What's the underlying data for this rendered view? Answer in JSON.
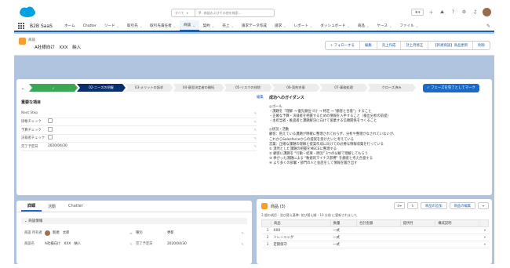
{
  "app": {
    "name": "B2B SaaS",
    "brand_color": "#00a1e0",
    "accent": "#1b6ac9"
  },
  "search": {
    "scope": "すべて",
    "placeholder": "商談およびその他を検索..."
  },
  "nav": {
    "items": [
      {
        "label": "ホーム",
        "dropdown": false
      },
      {
        "label": "Chatter",
        "dropdown": false
      },
      {
        "label": "リード",
        "dropdown": true
      },
      {
        "label": "取引先",
        "dropdown": true
      },
      {
        "label": "取引先責任者",
        "dropdown": true
      },
      {
        "label": "商談",
        "dropdown": true,
        "active": true
      },
      {
        "label": "契約",
        "dropdown": true
      },
      {
        "label": "売上",
        "dropdown": true
      },
      {
        "label": "請求データ作成",
        "dropdown": false
      },
      {
        "label": "請求",
        "dropdown": true
      },
      {
        "label": "レポート",
        "dropdown": true
      },
      {
        "label": "ダッシュボード",
        "dropdown": true
      },
      {
        "label": "商品",
        "dropdown": true
      },
      {
        "label": "ケース",
        "dropdown": true
      },
      {
        "label": "ファイル",
        "dropdown": true
      }
    ]
  },
  "record": {
    "type_label": "商談",
    "title": "A社様向け　XXX　納入",
    "actions": [
      "+ フォローする",
      "編集",
      "売上作成",
      "計上月修正",
      "【新規商談】商品更新",
      "削除"
    ]
  },
  "path": {
    "stages": [
      {
        "label": "✓",
        "state": "done"
      },
      {
        "label": "02-ニーズの把握",
        "state": "current"
      },
      {
        "label": "03-メリットの訴求",
        "state": "todo"
      },
      {
        "label": "04-意思決定者の開拓",
        "state": "todo"
      },
      {
        "label": "05-リスクの排除",
        "state": "todo"
      },
      {
        "label": "06-契約合意",
        "state": "todo"
      },
      {
        "label": "07-事務処理",
        "state": "todo"
      },
      {
        "label": "クローズ済み",
        "state": "todo"
      }
    ],
    "mark_button": "フェーズを完了としてマーク"
  },
  "key_fields": {
    "title": "重要な項目",
    "fields": [
      {
        "label": "Next Step",
        "value": "",
        "type": "text"
      },
      {
        "label": "掛帳チェック",
        "value": "",
        "type": "checkbox"
      },
      {
        "label": "予算チェック",
        "value": "",
        "type": "checkbox"
      },
      {
        "label": "決裁者チェック",
        "value": "",
        "type": "checkbox"
      },
      {
        "label": "完了予定日",
        "value": "2020/04/30",
        "type": "text"
      }
    ]
  },
  "guidance": {
    "edit_label": "編集",
    "title": "成功へのガイダンス",
    "lines": [
      {
        "text": "◎ゴール",
        "gap_before": false
      },
      {
        "text": "・課題を「理解 → 優先順位づけ → 特定 → \"顧客と合意\"」すること",
        "gap_before": false
      },
      {
        "text": "・正確な予算・決裁者を把握するための情報を入手すること（検出分析の前提）",
        "gap_before": false
      },
      {
        "text": "・主担当者・推進者と課題解決に向けて協業する信頼関係をつくること",
        "gap_before": false
      },
      {
        "text": "◎状況・活動",
        "gap_before": true
      },
      {
        "text": "顧客：抱えている課題が明確に整理されておらず、分析や整理がなされていないが、",
        "gap_before": false
      },
      {
        "text": "これからSalesforceからの提案を受けたいと考えている",
        "gap_before": false
      },
      {
        "text": "営業：正確な課題の理解と提案作成に向けての必要な情報収集を行っている",
        "gap_before": false
      },
      {
        "text": "① 漠然とした課題の把握をMECEに整理する",
        "gap_before": false
      },
      {
        "text": "② 顧客に課題を \"行動・結果・原因\" 3つの分解で理解してもらう",
        "gap_before": false
      },
      {
        "text": "③ 挙がった課題による \"数値的マイナス影響\" を顧客と考え合意する",
        "gap_before": false
      },
      {
        "text": "④ より多くの部署・部門の人と会話をして情報を聞き出す",
        "gap_before": false
      }
    ]
  },
  "detail": {
    "tabs": [
      "詳細",
      "活動",
      "Chatter"
    ],
    "active_tab": "詳細",
    "section": "商談情報",
    "rows": [
      {
        "l1": "商談 所有者",
        "v1": "新規　太郎",
        "avatar": true,
        "l2": "種別",
        "v2": "更新"
      },
      {
        "l1": "商談名",
        "v1": "A社様向け　XXX　納入",
        "avatar": false,
        "l2": "完了予定日",
        "v2": "2020/04/30"
      }
    ]
  },
  "products": {
    "title": "商品 (3)",
    "buttons": [
      "商品の追加",
      "商品の編集"
    ],
    "meta": "3 個の項目・並び替え基準: 並び替え順・10 分前 に更新されました",
    "columns": [
      "商品",
      "数量",
      "合計金額",
      "提供月",
      "構成説明"
    ],
    "rows": [
      {
        "n": "1",
        "product": "XXX",
        "qty": "一式",
        "total": "",
        "month": "",
        "desc": ""
      },
      {
        "n": "2",
        "product": "トレーニング",
        "qty": "一式",
        "total": "",
        "month": "",
        "desc": ""
      },
      {
        "n": "3",
        "product": "定期保守",
        "qty": "一式",
        "total": "",
        "month": "",
        "desc": ""
      }
    ]
  }
}
